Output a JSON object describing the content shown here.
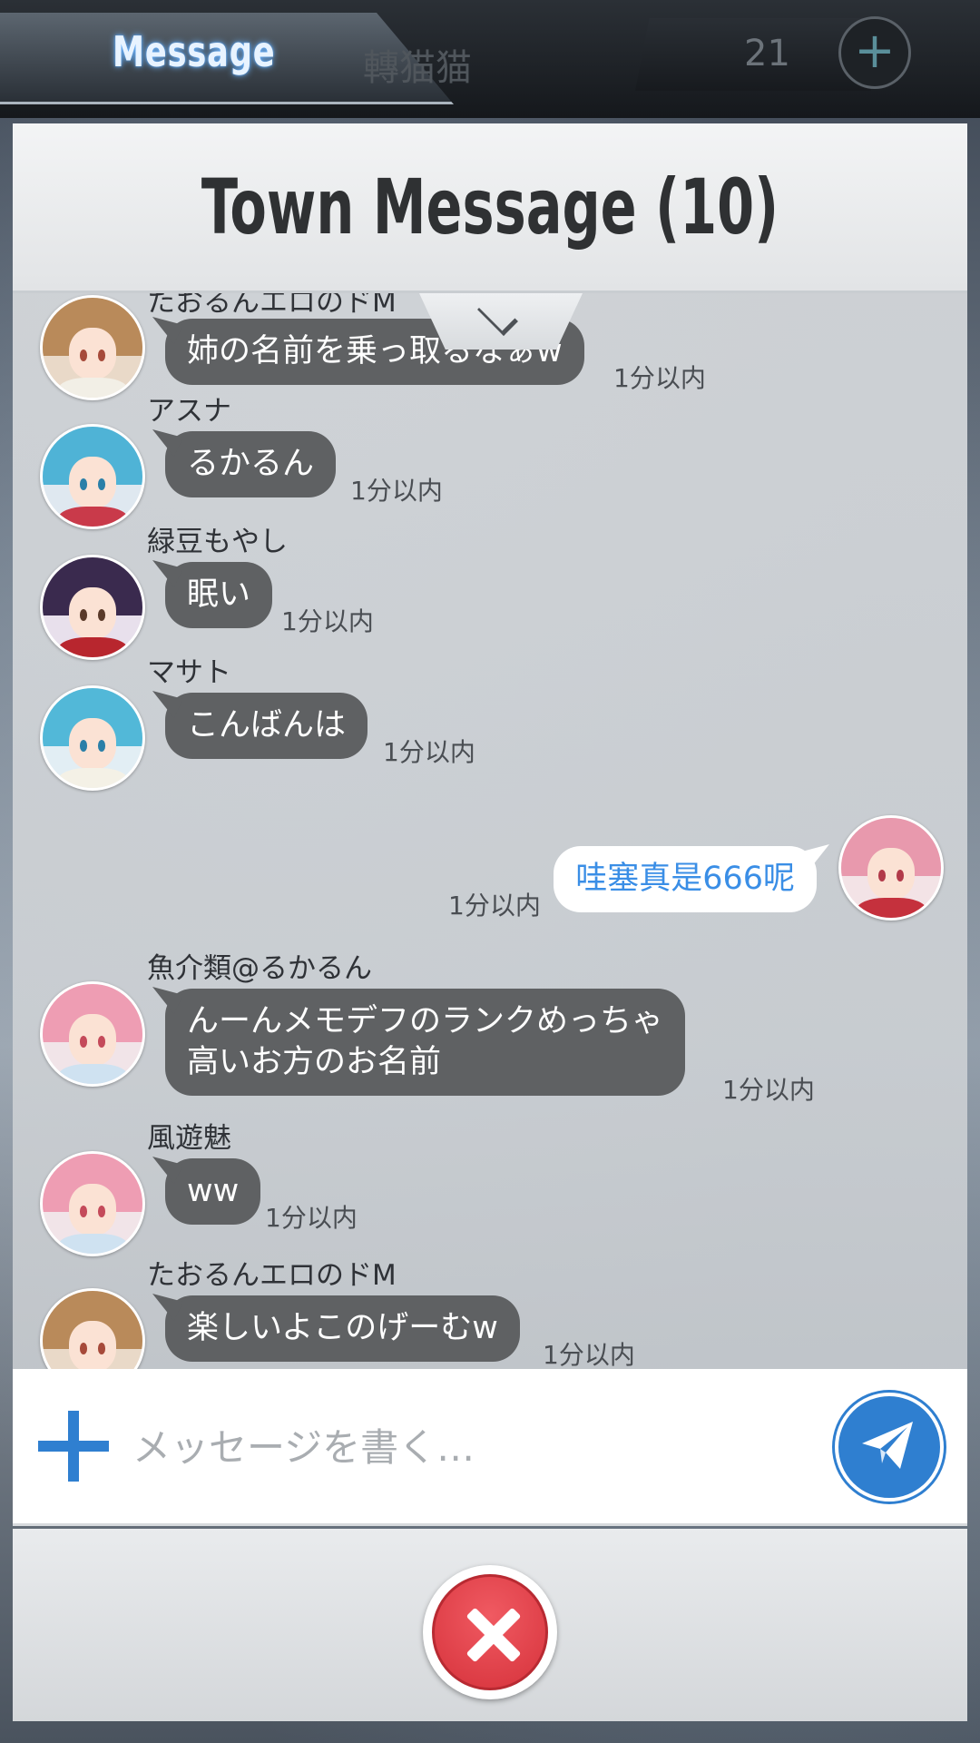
{
  "top_bar": {
    "tab_title": "Message",
    "ghost_name": "轉猫猫",
    "counter": "21",
    "plus_icon": "+"
  },
  "dialog": {
    "title": "Town Message (10)"
  },
  "messages": [
    {
      "sender": "たおるんエロのドM",
      "text": "姉の名前を乗っ取るなぁw",
      "time": "1分以内",
      "mine": false
    },
    {
      "sender": "アスナ",
      "text": "るかるん",
      "time": "1分以内",
      "mine": false
    },
    {
      "sender": "緑豆もやし",
      "text": "眠い",
      "time": "1分以内",
      "mine": false
    },
    {
      "sender": "マサト",
      "text": "こんばんは",
      "time": "1分以内",
      "mine": false
    },
    {
      "sender": "",
      "text": "哇塞真是666呢",
      "time": "1分以内",
      "mine": true
    },
    {
      "sender": "魚介類@るかるん",
      "text_line1": "んーんメモデフのランクめっちゃ",
      "text_line2": "高いお方のお名前",
      "time": "1分以内",
      "mine": false
    },
    {
      "sender": "風遊魅",
      "text": "ww",
      "time": "1分以内",
      "mine": false
    },
    {
      "sender": "たおるんエロのドM",
      "text": "楽しいよこのげーむw",
      "time": "1分以内",
      "mine": false
    }
  ],
  "input": {
    "placeholder": "メッセージを書く…",
    "value": ""
  },
  "icons": {
    "plus": "plus-icon",
    "send": "paper-plane-icon",
    "close": "close-icon",
    "collapse": "chevron-down-icon"
  },
  "colors": {
    "accent_blue": "#2f7fd0",
    "bubble_gray": "#5f6163",
    "close_red": "#e0434b",
    "mine_text": "#3a8ee6"
  }
}
